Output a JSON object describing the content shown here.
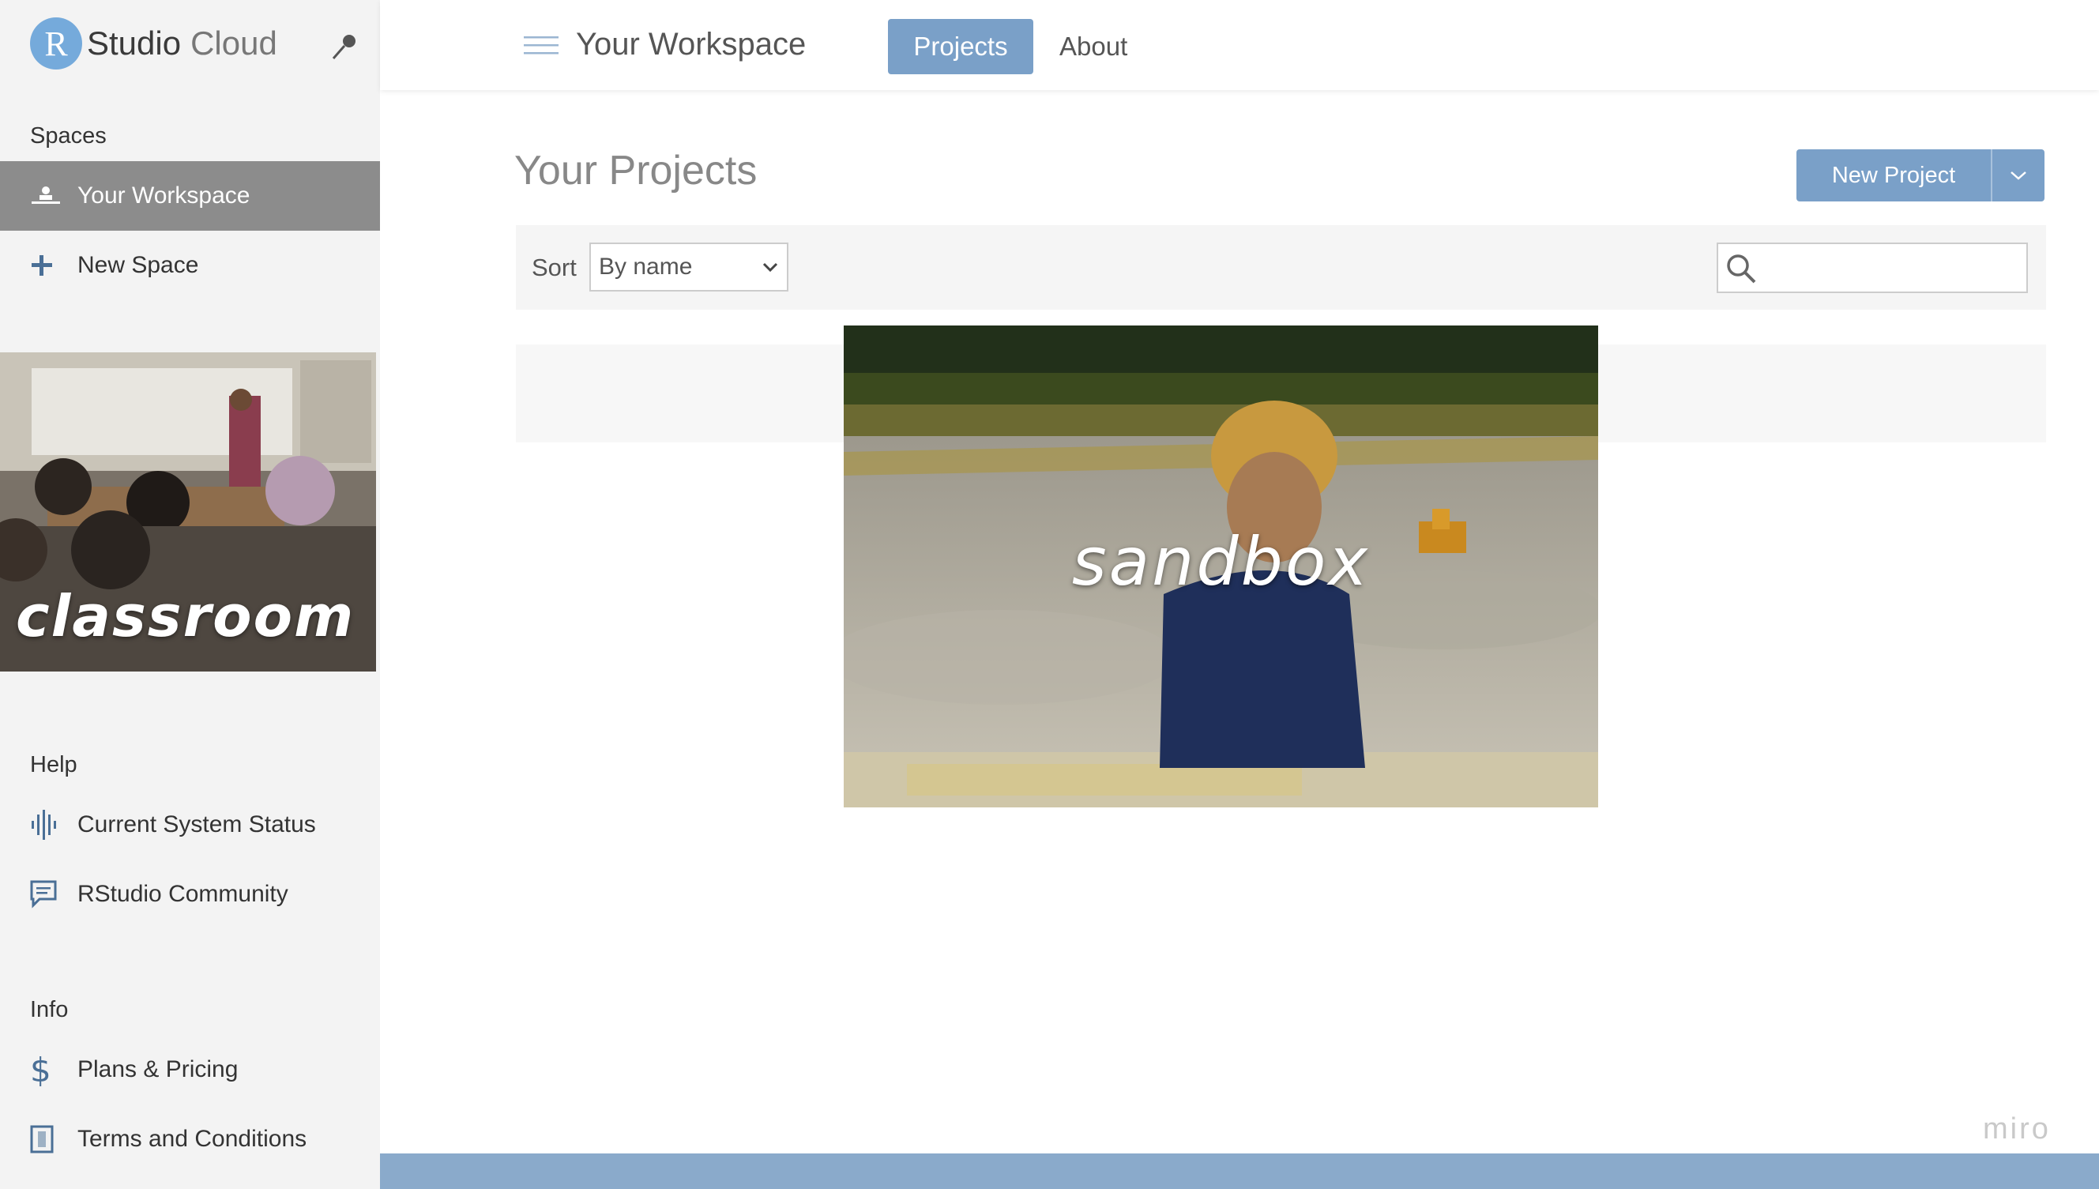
{
  "logo": {
    "letter": "R",
    "studio": "Studio",
    "cloud": "Cloud"
  },
  "sidebar": {
    "spaces_label": "Spaces",
    "workspace_item": "Your Workspace",
    "new_space_item": "New Space",
    "promo_text": "classroom",
    "help_label": "Help",
    "help_items": [
      "Current System Status",
      "RStudio Community"
    ],
    "info_label": "Info",
    "info_items": [
      "Plans & Pricing",
      "Terms and Conditions"
    ]
  },
  "header": {
    "title": "Your Workspace",
    "tabs": [
      "Projects",
      "About"
    ],
    "active_tab": "Projects"
  },
  "main": {
    "title": "Your Projects",
    "new_project_label": "New Project",
    "sort_label": "Sort",
    "sort_value": "By name",
    "search_value": ""
  },
  "overlay": {
    "sandbox_text": "sandbox"
  },
  "watermark": "miro",
  "colors": {
    "accent": "#7aa0c8",
    "brand": "#75aadb",
    "sidebar_active": "#8c8c8c",
    "footer": "#8aaacb"
  }
}
